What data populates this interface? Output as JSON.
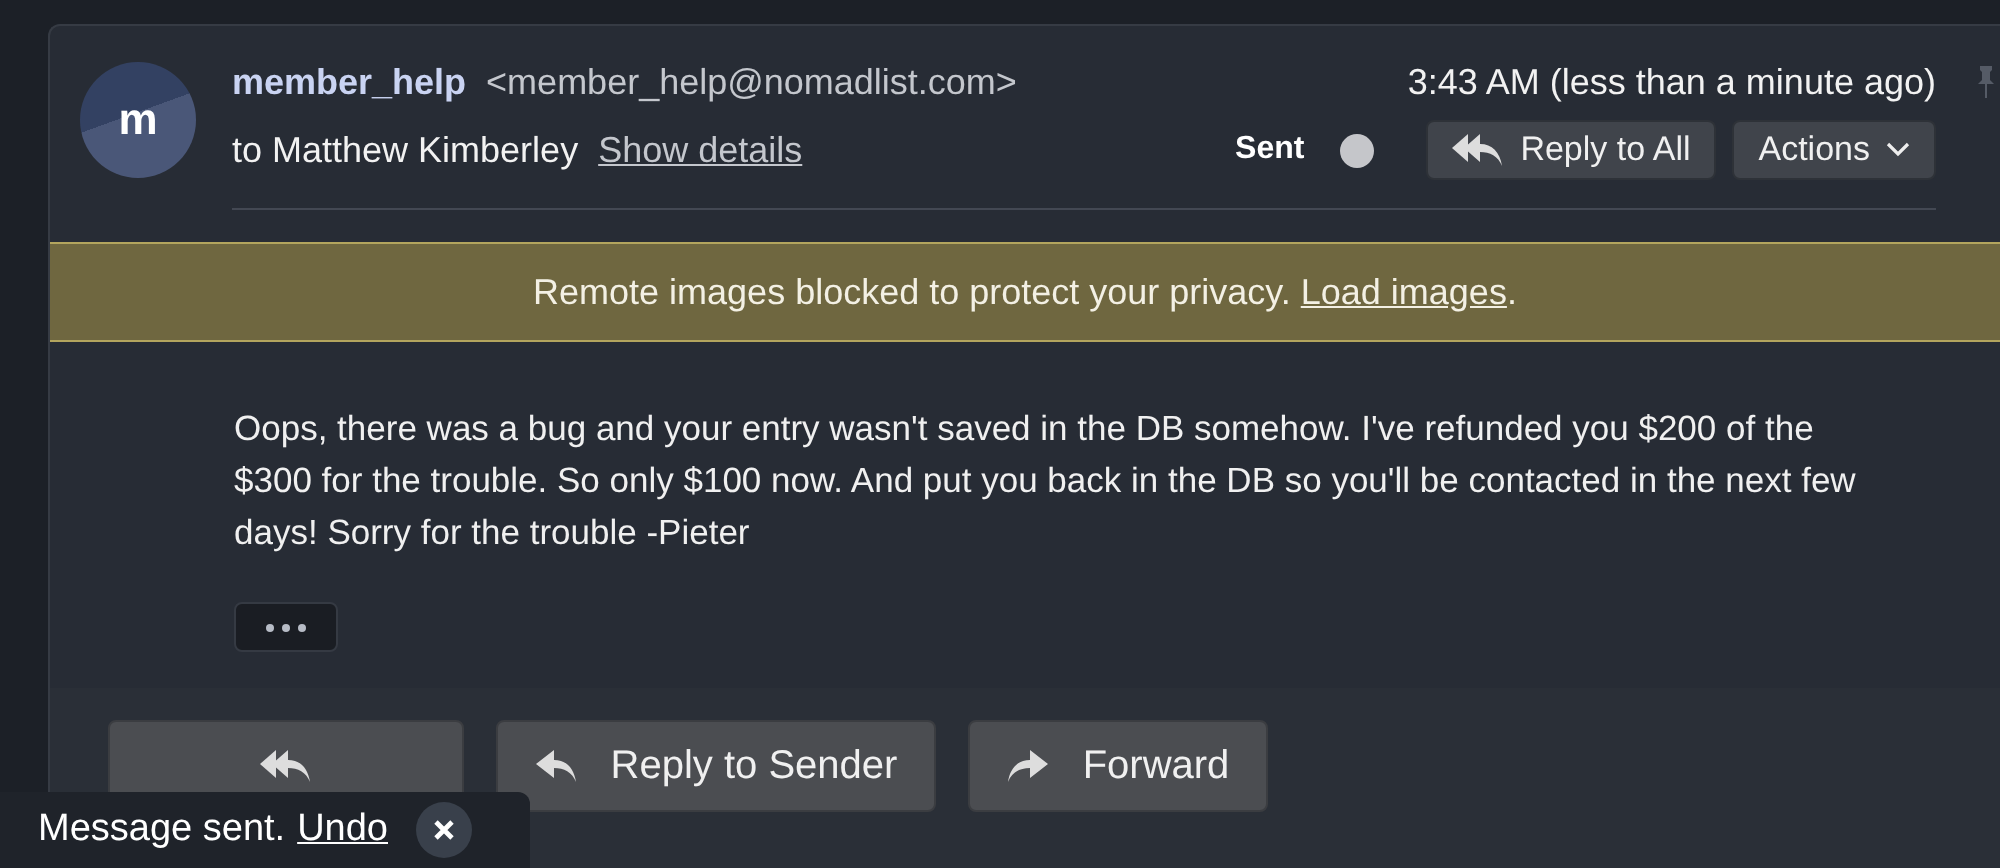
{
  "message": {
    "avatar_letter": "m",
    "sender_name": "member_help",
    "sender_email": "<member_help@nomadlist.com>",
    "recipient": "to Matthew Kimberley",
    "details_link": "Show details",
    "time": "3:43 AM (less than a minute ago)",
    "status": "Sent",
    "reply_all": "Reply to All",
    "actions": "Actions"
  },
  "banner": {
    "text": "Remote images blocked to protect your privacy.",
    "link": "Load images",
    "end": "."
  },
  "body": "Oops, there was a bug and your entry wasn't saved in the DB somehow. I've refunded you $200 of the $300 for the trouble. So only $100 now. And put you back in the DB so you'll be contacted in the next few days! Sorry for the trouble -Pieter",
  "footer_buttons": [
    {
      "kind": "reply-all"
    },
    {
      "kind": "reply",
      "label": "Reply to Sender"
    },
    {
      "kind": "forward",
      "label": "Forward"
    }
  ],
  "toast": {
    "text": "Message sent.",
    "link": "Undo"
  }
}
